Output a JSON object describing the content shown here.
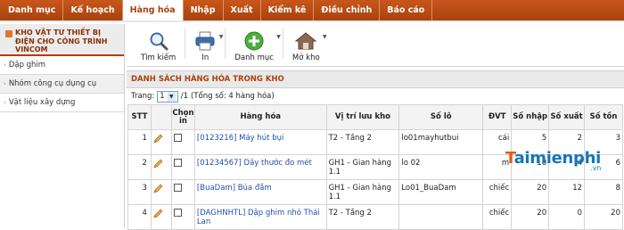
{
  "nav": {
    "tabs": [
      {
        "label": "Danh mục",
        "active": false
      },
      {
        "label": "Kế hoạch",
        "active": false
      },
      {
        "label": "Hàng hóa",
        "active": true
      },
      {
        "label": "Nhập",
        "active": false
      },
      {
        "label": "Xuất",
        "active": false
      },
      {
        "label": "Kiểm kê",
        "active": false
      },
      {
        "label": "Điều chỉnh",
        "active": false
      },
      {
        "label": "Báo cáo",
        "active": false
      }
    ]
  },
  "sidebar": {
    "header": "KHO VẬT TƯ THIẾT BỊ ĐIỆN CHO CÔNG TRÌNH VINCOM",
    "items": [
      {
        "label": "Dập ghim"
      },
      {
        "label": "Nhóm công cụ dụng cụ"
      },
      {
        "label": "Vật liệu xây dựng"
      }
    ]
  },
  "toolbar": {
    "search_label": "Tìm kiếm",
    "print_label": "In",
    "category_label": "Danh mục",
    "open_warehouse_label": "Mở kho"
  },
  "list": {
    "title": "DANH SÁCH HÀNG HÓA TRONG KHO",
    "page_label": "Trang:",
    "page_value": "1",
    "page_total": "/1",
    "summary": "(Tổng số: 4 hàng hóa)"
  },
  "table": {
    "headers": {
      "stt": "STT",
      "select": "Chọn in",
      "item": "Hàng hóa",
      "location": "Vị trí lưu kho",
      "lot": "Số lô",
      "unit": "ĐVT",
      "in": "Số nhập",
      "out": "Số xuất",
      "stock": "Số tồn"
    },
    "rows": [
      {
        "stt": "1",
        "item": "[0123216] Máy hút bụi",
        "location": "T2 - Tầng 2",
        "lot": "lo01mayhutbui",
        "unit": "cái",
        "in": "5",
        "out": "2",
        "stock": "3"
      },
      {
        "stt": "2",
        "item": "[01234567] Dây thước đo mét",
        "location": "GH1 - Gian hàng 1.1",
        "lot": "lo 02",
        "unit": "m",
        "in": "10",
        "out": "4",
        "stock": "6"
      },
      {
        "stt": "3",
        "item": "[BuaDam] Búa đầm",
        "location": "GH1 - Gian hàng 1.1",
        "lot": "Lo01_BuaDam",
        "unit": "chiếc",
        "in": "20",
        "out": "12",
        "stock": "8"
      },
      {
        "stt": "4",
        "item": "[DAGHNHTL] Dập ghim nhỏ Thái Lan",
        "location": "T2 - Tầng 2",
        "lot": "",
        "unit": "chiếc",
        "in": "20",
        "out": "0",
        "stock": "20"
      }
    ]
  },
  "watermark": {
    "brand_a": "T",
    "brand_b": "aimienphi",
    "suffix": ".vn"
  },
  "colors": {
    "accent": "#b53b0e",
    "link": "#2250a8",
    "nav_bg": "#c0501a"
  }
}
